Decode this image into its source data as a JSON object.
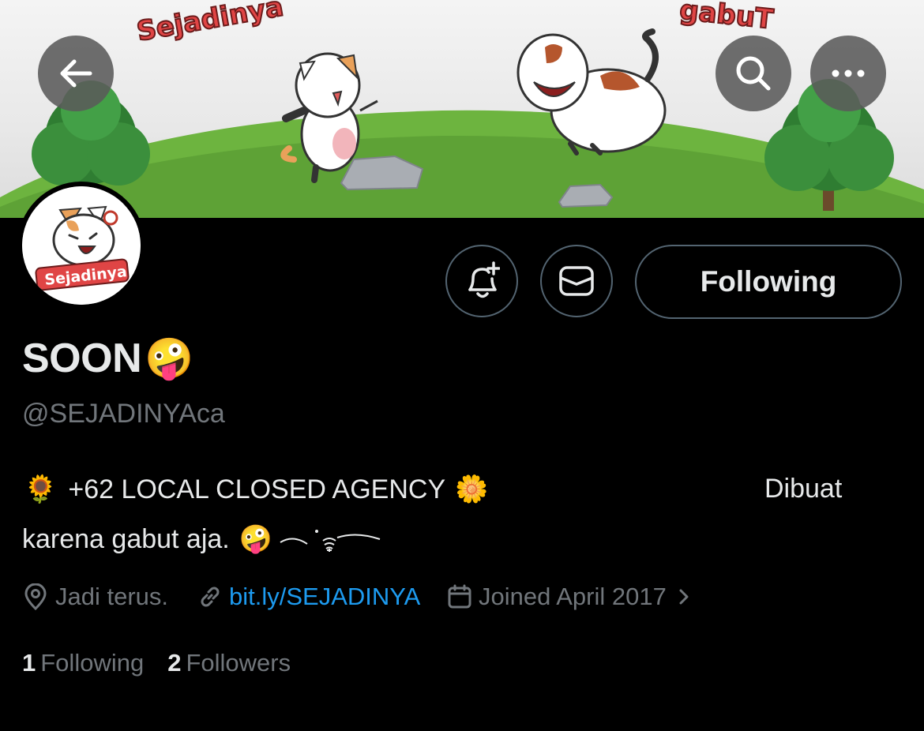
{
  "banner": {
    "text_left": "Sejadinya",
    "text_right": "gabuT"
  },
  "header": {
    "back_icon": "arrow-left-icon",
    "search_icon": "search-icon",
    "more_icon": "more-horizontal-icon"
  },
  "avatar": {
    "logo_text": "Sejadinya"
  },
  "actions": {
    "notify_icon": "bell-plus-icon",
    "message_icon": "envelope-icon",
    "follow_label": "Following"
  },
  "profile": {
    "display_name": "SOON",
    "name_emoji": "🤪",
    "handle": "@SEJADINYAca",
    "bio_line1_emoji_left": "🌻",
    "bio_line1": "+62 LOCAL CLOSED AGENCY",
    "bio_line1_emoji_right": "🌼",
    "bio_right_label": "Dibuat",
    "bio_line2": "karena gabut aja.",
    "bio_line2_emoji": "🤪"
  },
  "meta": {
    "location_icon": "location-pin-icon",
    "location": "Jadi terus.",
    "link_icon": "link-icon",
    "link": "bit.ly/SEJADINYA",
    "calendar_icon": "calendar-icon",
    "joined": "Joined April 2017",
    "chevron_icon": "chevron-right-icon"
  },
  "stats": {
    "following_count": "1",
    "following_label": "Following",
    "followers_count": "2",
    "followers_label": "Followers"
  },
  "colors": {
    "background": "#000000",
    "text_primary": "#e7e9ea",
    "text_secondary": "#71767b",
    "link": "#1d9bf0",
    "border": "#536471"
  }
}
